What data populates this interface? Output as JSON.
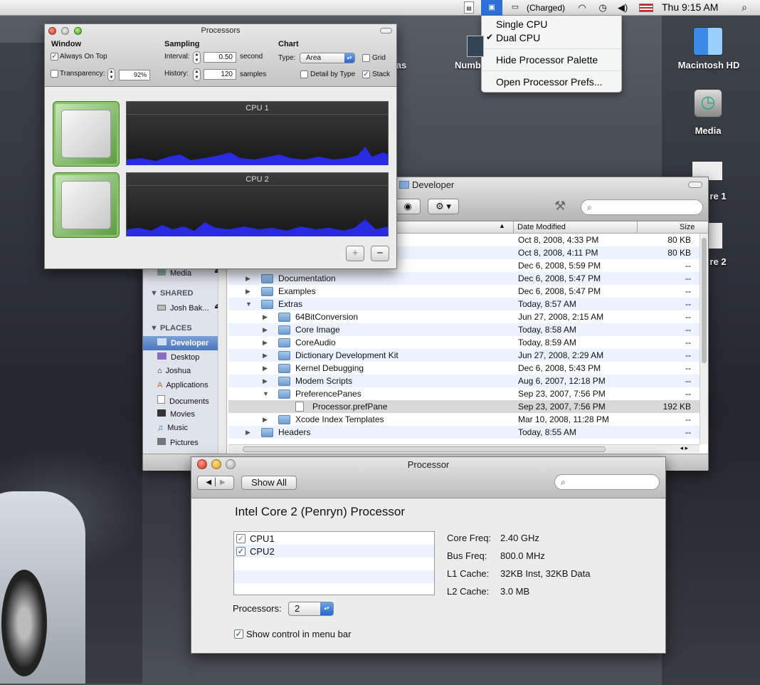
{
  "menubar": {
    "status": "(Charged)",
    "clock": "Thu 9:15 AM"
  },
  "menu": {
    "items": [
      {
        "label": "Single CPU",
        "checked": false
      },
      {
        "label": "Dual CPU",
        "checked": true
      }
    ],
    "hide": "Hide Processor Palette",
    "prefs": "Open Processor Prefs..."
  },
  "desktop": {
    "icons": [
      "Macintosh HD",
      "Media",
      "re 1",
      "re 2",
      "Numb",
      "as"
    ]
  },
  "palette": {
    "title": "Processors",
    "window": {
      "heading": "Window",
      "always_on_top": "Always On Top",
      "transparency": "Transparency:",
      "transparency_value": "92%"
    },
    "sampling": {
      "heading": "Sampling",
      "interval": "Interval:",
      "interval_value": "0.50",
      "interval_unit": "second",
      "history": "History:",
      "history_value": "120",
      "history_unit": "samples"
    },
    "chart": {
      "heading": "Chart",
      "type": "Type:",
      "type_value": "Area",
      "grid": "Grid",
      "detail": "Detail by Type",
      "stack": "Stack"
    },
    "cpus": [
      "CPU 1",
      "CPU 2"
    ],
    "add": "+",
    "remove": "−"
  },
  "finder": {
    "title": "Developer",
    "columns": {
      "date": "Date Modified",
      "size": "Size"
    },
    "sidebar": {
      "media": "Media",
      "shared": "SHARED",
      "shared_item": "Josh Bak...",
      "places": "PLACES",
      "items": [
        "Developer",
        "Desktop",
        "Joshua",
        "Applications",
        "Documents",
        "Movies",
        "Music",
        "Pictures"
      ]
    },
    "rows": [
      {
        "name": "",
        "date": "Oct 8, 2008, 4:33 PM",
        "size": "80 KB",
        "level": 0,
        "kind": "none"
      },
      {
        "name": "",
        "date": "Oct 8, 2008, 4:11 PM",
        "size": "80 KB",
        "level": 0,
        "kind": "none"
      },
      {
        "name": "",
        "date": "Dec 6, 2008, 5:59 PM",
        "size": "--",
        "level": 0,
        "kind": "none"
      },
      {
        "name": "Documentation",
        "date": "Dec 6, 2008, 5:47 PM",
        "size": "--",
        "level": 0,
        "kind": "folder"
      },
      {
        "name": "Examples",
        "date": "Dec 6, 2008, 5:47 PM",
        "size": "--",
        "level": 0,
        "kind": "folder"
      },
      {
        "name": "Extras",
        "date": "Today, 8:57 AM",
        "size": "--",
        "level": 0,
        "kind": "folder-open"
      },
      {
        "name": "64BitConversion",
        "date": "Jun 27, 2008, 2:15 AM",
        "size": "--",
        "level": 1,
        "kind": "folder"
      },
      {
        "name": "Core Image",
        "date": "Today, 8:58 AM",
        "size": "--",
        "level": 1,
        "kind": "folder"
      },
      {
        "name": "CoreAudio",
        "date": "Today, 8:59 AM",
        "size": "--",
        "level": 1,
        "kind": "folder"
      },
      {
        "name": "Dictionary Development Kit",
        "date": "Jun 27, 2008, 2:29 AM",
        "size": "--",
        "level": 1,
        "kind": "folder"
      },
      {
        "name": "Kernel Debugging",
        "date": "Dec 6, 2008, 5:43 PM",
        "size": "--",
        "level": 1,
        "kind": "folder"
      },
      {
        "name": "Modem Scripts",
        "date": "Aug 6, 2007, 12:18 PM",
        "size": "--",
        "level": 1,
        "kind": "folder"
      },
      {
        "name": "PreferencePanes",
        "date": "Sep 23, 2007, 7:56 PM",
        "size": "--",
        "level": 1,
        "kind": "folder-open"
      },
      {
        "name": "Processor.prefPane",
        "date": "Sep 23, 2007, 7:56 PM",
        "size": "192 KB",
        "level": 2,
        "kind": "file"
      },
      {
        "name": "Xcode Index Templates",
        "date": "Mar 10, 2008, 11:28 PM",
        "size": "--",
        "level": 1,
        "kind": "folder"
      },
      {
        "name": "Headers",
        "date": "Today, 8:55 AM",
        "size": "--",
        "level": 0,
        "kind": "folder"
      }
    ]
  },
  "prefs": {
    "title": "Processor",
    "show_all": "Show All",
    "heading": "Intel Core 2 (Penryn) Processor",
    "cpus": [
      {
        "label": "CPU1",
        "checked": true
      },
      {
        "label": "CPU2",
        "checked": true
      }
    ],
    "info": [
      {
        "label": "Core Freq:",
        "value": "2.40 GHz"
      },
      {
        "label": "Bus Freq:",
        "value": "800.0 MHz"
      },
      {
        "label": "L1 Cache:",
        "value": "32KB Inst, 32KB Data"
      },
      {
        "label": "L2 Cache:",
        "value": "3.0 MB"
      }
    ],
    "processors_label": "Processors:",
    "processors_value": "2",
    "show_control": "Show control in menu bar"
  }
}
